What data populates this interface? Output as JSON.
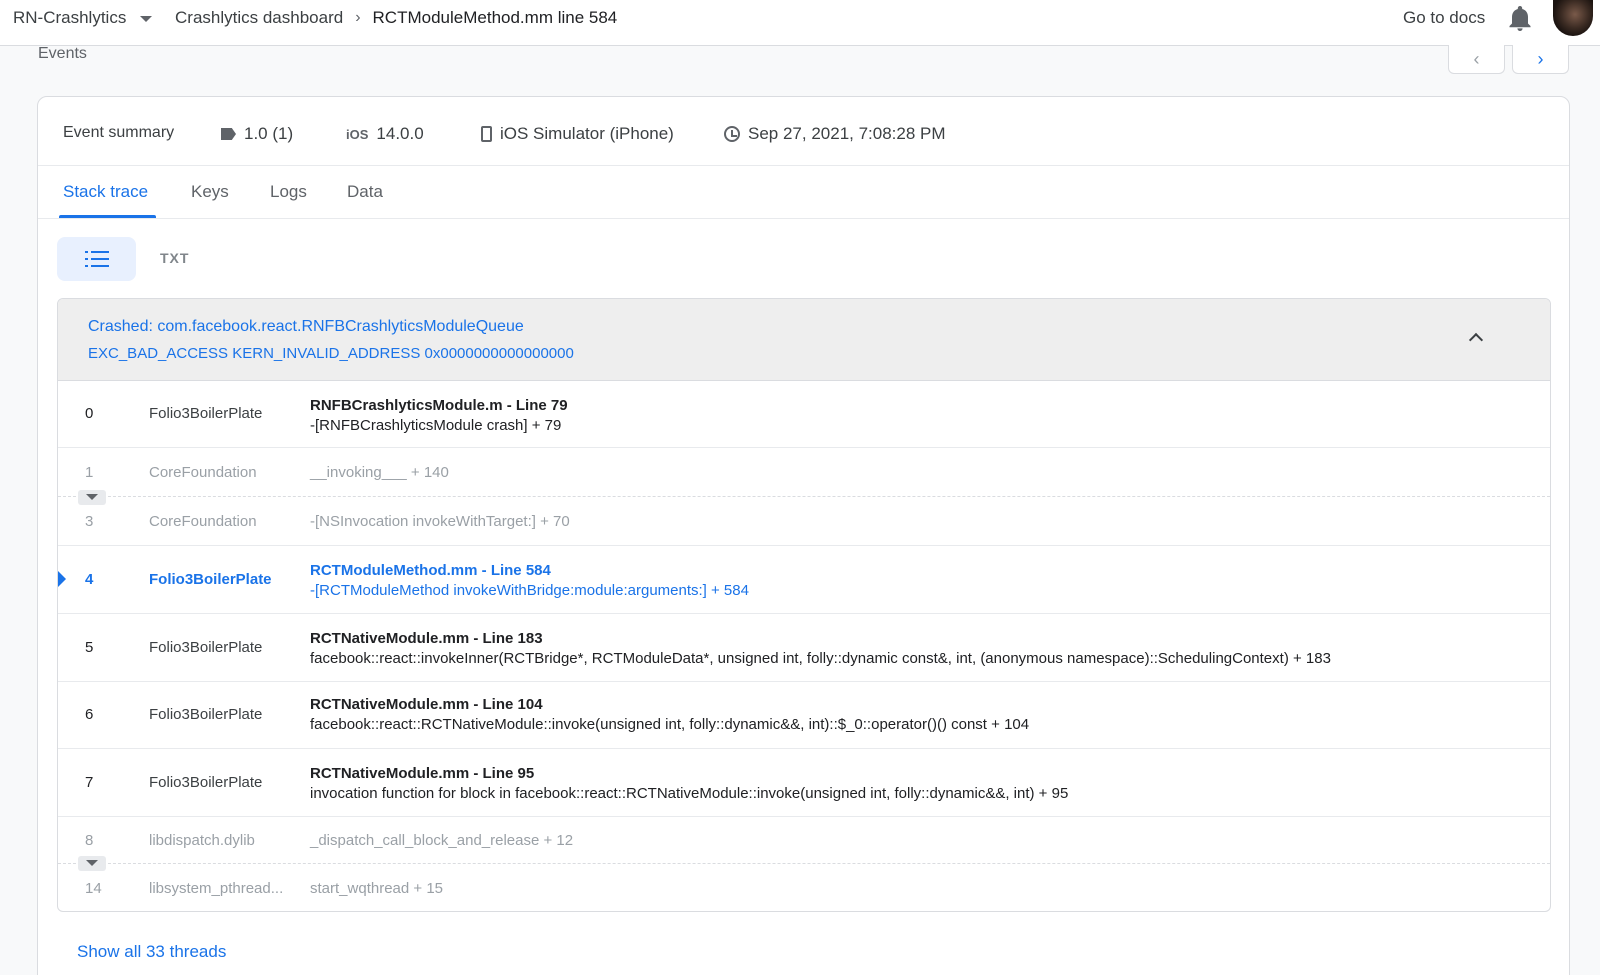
{
  "topbar": {
    "project": "RN-Crashlytics",
    "breadcrumb_link": "Crashlytics dashboard",
    "breadcrumb_sep": "›",
    "breadcrumb_current": "RCTModuleMethod.mm line 584",
    "docs": "Go to docs"
  },
  "events": {
    "label": "Events",
    "prev": "‹",
    "next": "›"
  },
  "summary": {
    "title": "Event summary",
    "version": "1.0 (1)",
    "os_icon_text": "iOS",
    "os_version": "14.0.0",
    "device": "iOS Simulator (iPhone)",
    "timestamp": "Sep 27, 2021, 7:08:28 PM"
  },
  "tabs": [
    "Stack trace",
    "Keys",
    "Logs",
    "Data"
  ],
  "view": {
    "txt_label": "TXT"
  },
  "thread": {
    "title": "Crashed: com.facebook.react.RNFBCrashlyticsModuleQueue",
    "exception": "EXC_BAD_ACCESS KERN_INVALID_ADDRESS 0x0000000000000000",
    "frames": [
      {
        "num": "0",
        "lib": "Folio3BoilerPlate",
        "file": "RNFBCrashlyticsModule.m - Line 79",
        "detail": "-[RNFBCrashlyticsModule crash] + 79",
        "state": "normal"
      },
      {
        "num": "1",
        "lib": "CoreFoundation",
        "file": "",
        "detail": "__invoking___ + 140",
        "state": "dim"
      },
      {
        "num": "3",
        "lib": "CoreFoundation",
        "file": "",
        "detail": "-[NSInvocation invokeWithTarget:] + 70",
        "state": "dim"
      },
      {
        "num": "4",
        "lib": "Folio3BoilerPlate",
        "file": "RCTModuleMethod.mm - Line 584",
        "detail": "-[RCTModuleMethod invokeWithBridge:module:arguments:] + 584",
        "state": "highlight"
      },
      {
        "num": "5",
        "lib": "Folio3BoilerPlate",
        "file": "RCTNativeModule.mm - Line 183",
        "detail": "facebook::react::invokeInner(RCTBridge*, RCTModuleData*, unsigned int, folly::dynamic const&, int, (anonymous namespace)::SchedulingContext) + 183",
        "state": "normal"
      },
      {
        "num": "6",
        "lib": "Folio3BoilerPlate",
        "file": "RCTNativeModule.mm - Line 104",
        "detail": "facebook::react::RCTNativeModule::invoke(unsigned int, folly::dynamic&&, int)::$_0::operator()() const + 104",
        "state": "normal"
      },
      {
        "num": "7",
        "lib": "Folio3BoilerPlate",
        "file": "RCTNativeModule.mm - Line 95",
        "detail": "invocation function for block in facebook::react::RCTNativeModule::invoke(unsigned int, folly::dynamic&&, int) + 95",
        "state": "normal"
      },
      {
        "num": "8",
        "lib": "libdispatch.dylib",
        "file": "",
        "detail": "_dispatch_call_block_and_release + 12",
        "state": "dim"
      },
      {
        "num": "14",
        "lib": "libsystem_pthread...",
        "file": "",
        "detail": "start_wqthread + 15",
        "state": "dim"
      }
    ]
  },
  "show_all": "Show all 33 threads",
  "colors": {
    "accent": "#1a73e8",
    "text": "#3c4043",
    "muted": "#9aa0a6"
  }
}
